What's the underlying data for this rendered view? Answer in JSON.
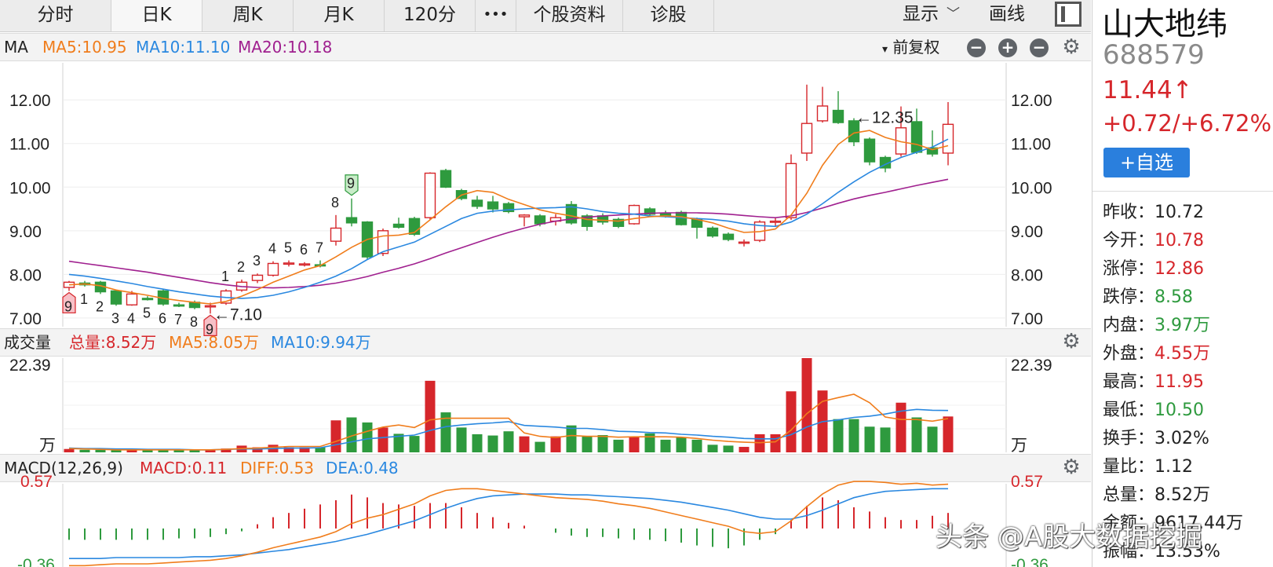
{
  "tabs": [
    {
      "label": "分时",
      "active": false
    },
    {
      "label": "日K",
      "active": true
    },
    {
      "label": "周K",
      "active": false
    },
    {
      "label": "月K",
      "active": false
    },
    {
      "label": "120分",
      "active": false
    },
    {
      "label": "•••",
      "active": false
    },
    {
      "label": "个股资料",
      "active": false
    },
    {
      "label": "诊股",
      "active": false
    }
  ],
  "toolbar": {
    "display_label": "显示",
    "draw_label": "画线"
  },
  "kline_header": {
    "indicator": "MA",
    "ma5": "MA5:10.95",
    "ma10": "MA10:11.10",
    "ma20": "MA20:10.18",
    "adjust_label": "前复权"
  },
  "volume_header": {
    "indicator": "成交量",
    "total": "总量:8.52万",
    "ma5": "MA5:8.05万",
    "ma10": "MA10:9.94万"
  },
  "macd_header": {
    "indicator": "MACD(12,26,9)",
    "macd": "MACD:0.11",
    "diff": "DIFF:0.53",
    "dea": "DEA:0.48"
  },
  "colors": {
    "up": "#d6262b",
    "down": "#2e9a3e",
    "ma5": "#f07d1c",
    "ma10": "#2a88e0",
    "ma20": "#a0208f"
  },
  "chart_data": [
    {
      "type": "candlestick",
      "y_ticks": [
        "12.00",
        "11.00",
        "10.00",
        "9.00",
        "8.00",
        "7.00"
      ],
      "ylim": [
        6.8,
        12.85
      ],
      "annotations": [
        {
          "label": "←12.35",
          "candle_index": 50
        },
        {
          "label": "←7.10",
          "candle_index": 9
        }
      ],
      "td_labels_low": [
        {
          "i": 0,
          "t": "9"
        },
        {
          "i": 1,
          "t": "1"
        },
        {
          "i": 2,
          "t": "2"
        },
        {
          "i": 3,
          "t": "3"
        },
        {
          "i": 4,
          "t": "4"
        },
        {
          "i": 5,
          "t": "5"
        },
        {
          "i": 6,
          "t": "6"
        },
        {
          "i": 7,
          "t": "7"
        },
        {
          "i": 8,
          "t": "8"
        },
        {
          "i": 9,
          "t": "9"
        }
      ],
      "td_labels_high": [
        {
          "i": 10,
          "t": "1"
        },
        {
          "i": 11,
          "t": "2"
        },
        {
          "i": 12,
          "t": "3"
        },
        {
          "i": 13,
          "t": "4"
        },
        {
          "i": 14,
          "t": "5"
        },
        {
          "i": 15,
          "t": "6"
        },
        {
          "i": 16,
          "t": "7"
        },
        {
          "i": 17,
          "t": "8"
        },
        {
          "i": 18,
          "t": "9"
        }
      ],
      "candles": [
        {
          "o": 7.7,
          "h": 7.85,
          "l": 7.62,
          "c": 7.82
        },
        {
          "o": 7.8,
          "h": 7.85,
          "l": 7.72,
          "c": 7.76
        },
        {
          "o": 7.82,
          "h": 7.85,
          "l": 7.55,
          "c": 7.6
        },
        {
          "o": 7.62,
          "h": 7.65,
          "l": 7.28,
          "c": 7.32
        },
        {
          "o": 7.3,
          "h": 7.62,
          "l": 7.28,
          "c": 7.55
        },
        {
          "o": 7.45,
          "h": 7.5,
          "l": 7.4,
          "c": 7.42
        },
        {
          "o": 7.62,
          "h": 7.66,
          "l": 7.28,
          "c": 7.32
        },
        {
          "o": 7.3,
          "h": 7.35,
          "l": 7.25,
          "c": 7.28
        },
        {
          "o": 7.36,
          "h": 7.4,
          "l": 7.2,
          "c": 7.24
        },
        {
          "o": 7.26,
          "h": 7.35,
          "l": 7.1,
          "c": 7.28
        },
        {
          "o": 7.34,
          "h": 7.66,
          "l": 7.3,
          "c": 7.62
        },
        {
          "o": 7.64,
          "h": 7.88,
          "l": 7.6,
          "c": 7.82
        },
        {
          "o": 7.86,
          "h": 8.02,
          "l": 7.8,
          "c": 7.98
        },
        {
          "o": 7.98,
          "h": 8.3,
          "l": 7.95,
          "c": 8.25
        },
        {
          "o": 8.24,
          "h": 8.32,
          "l": 8.18,
          "c": 8.26
        },
        {
          "o": 8.22,
          "h": 8.28,
          "l": 8.18,
          "c": 8.24
        },
        {
          "o": 8.22,
          "h": 8.32,
          "l": 8.16,
          "c": 8.2
        },
        {
          "o": 8.76,
          "h": 9.36,
          "l": 8.66,
          "c": 9.06
        },
        {
          "o": 9.3,
          "h": 9.74,
          "l": 9.1,
          "c": 9.18
        },
        {
          "o": 9.2,
          "h": 9.22,
          "l": 8.35,
          "c": 8.4
        },
        {
          "o": 8.48,
          "h": 9.05,
          "l": 8.42,
          "c": 9.0
        },
        {
          "o": 9.15,
          "h": 9.3,
          "l": 9.05,
          "c": 9.08
        },
        {
          "o": 9.28,
          "h": 9.32,
          "l": 8.88,
          "c": 8.92
        },
        {
          "o": 9.3,
          "h": 10.34,
          "l": 9.25,
          "c": 10.32
        },
        {
          "o": 10.38,
          "h": 10.42,
          "l": 9.98,
          "c": 10.0
        },
        {
          "o": 9.92,
          "h": 9.96,
          "l": 9.7,
          "c": 9.74
        },
        {
          "o": 9.7,
          "h": 9.8,
          "l": 9.5,
          "c": 9.56
        },
        {
          "o": 9.66,
          "h": 9.8,
          "l": 9.42,
          "c": 9.5
        },
        {
          "o": 9.62,
          "h": 9.66,
          "l": 9.4,
          "c": 9.44
        },
        {
          "o": 9.32,
          "h": 9.38,
          "l": 9.1,
          "c": 9.36
        },
        {
          "o": 9.34,
          "h": 9.38,
          "l": 9.1,
          "c": 9.16
        },
        {
          "o": 9.22,
          "h": 9.38,
          "l": 9.12,
          "c": 9.3
        },
        {
          "o": 9.6,
          "h": 9.68,
          "l": 9.14,
          "c": 9.18
        },
        {
          "o": 9.34,
          "h": 9.38,
          "l": 9.0,
          "c": 9.1
        },
        {
          "o": 9.34,
          "h": 9.4,
          "l": 9.14,
          "c": 9.2
        },
        {
          "o": 9.26,
          "h": 9.3,
          "l": 9.06,
          "c": 9.1
        },
        {
          "o": 9.16,
          "h": 9.6,
          "l": 9.14,
          "c": 9.58
        },
        {
          "o": 9.5,
          "h": 9.54,
          "l": 9.34,
          "c": 9.38
        },
        {
          "o": 9.4,
          "h": 9.46,
          "l": 9.3,
          "c": 9.34
        },
        {
          "o": 9.42,
          "h": 9.46,
          "l": 9.12,
          "c": 9.14
        },
        {
          "o": 9.26,
          "h": 9.3,
          "l": 8.82,
          "c": 9.08
        },
        {
          "o": 9.06,
          "h": 9.1,
          "l": 8.84,
          "c": 8.88
        },
        {
          "o": 8.92,
          "h": 8.96,
          "l": 8.76,
          "c": 8.8
        },
        {
          "o": 8.72,
          "h": 8.8,
          "l": 8.64,
          "c": 8.74
        },
        {
          "o": 8.78,
          "h": 9.24,
          "l": 8.74,
          "c": 9.2
        },
        {
          "o": 9.2,
          "h": 9.3,
          "l": 9.1,
          "c": 9.22
        },
        {
          "o": 9.3,
          "h": 10.75,
          "l": 9.25,
          "c": 10.54
        },
        {
          "o": 10.78,
          "h": 12.35,
          "l": 10.6,
          "c": 11.46
        },
        {
          "o": 11.52,
          "h": 12.3,
          "l": 11.48,
          "c": 11.86
        },
        {
          "o": 11.76,
          "h": 12.2,
          "l": 11.45,
          "c": 11.48
        },
        {
          "o": 11.52,
          "h": 11.58,
          "l": 10.94,
          "c": 11.04
        },
        {
          "o": 11.1,
          "h": 11.14,
          "l": 10.5,
          "c": 10.58
        },
        {
          "o": 10.68,
          "h": 10.72,
          "l": 10.34,
          "c": 10.44
        },
        {
          "o": 10.76,
          "h": 11.85,
          "l": 10.7,
          "c": 11.36
        },
        {
          "o": 11.5,
          "h": 11.8,
          "l": 10.76,
          "c": 10.8
        },
        {
          "o": 10.9,
          "h": 11.3,
          "l": 10.7,
          "c": 10.76
        },
        {
          "o": 10.78,
          "h": 11.95,
          "l": 10.5,
          "c": 11.44
        }
      ],
      "ma5": [
        7.76,
        7.78,
        7.74,
        7.64,
        7.58,
        7.52,
        7.45,
        7.4,
        7.36,
        7.32,
        7.38,
        7.5,
        7.65,
        7.82,
        7.96,
        8.1,
        8.2,
        8.4,
        8.62,
        8.8,
        8.88,
        8.9,
        8.96,
        9.25,
        9.55,
        9.82,
        9.92,
        9.88,
        9.72,
        9.6,
        9.48,
        9.4,
        9.34,
        9.26,
        9.24,
        9.22,
        9.28,
        9.32,
        9.34,
        9.32,
        9.26,
        9.18,
        9.06,
        8.96,
        8.98,
        9.04,
        9.36,
        9.86,
        10.5,
        10.98,
        11.24,
        11.3,
        11.14,
        11.04,
        10.98,
        10.86,
        10.95
      ],
      "ma10": [
        8.0,
        7.96,
        7.91,
        7.85,
        7.79,
        7.72,
        7.66,
        7.6,
        7.55,
        7.5,
        7.47,
        7.45,
        7.47,
        7.52,
        7.6,
        7.7,
        7.82,
        7.96,
        8.13,
        8.34,
        8.52,
        8.63,
        8.74,
        8.92,
        9.1,
        9.28,
        9.4,
        9.45,
        9.48,
        9.5,
        9.52,
        9.53,
        9.55,
        9.5,
        9.44,
        9.4,
        9.38,
        9.34,
        9.32,
        9.3,
        9.28,
        9.26,
        9.22,
        9.16,
        9.12,
        9.1,
        9.2,
        9.38,
        9.62,
        9.88,
        10.12,
        10.34,
        10.52,
        10.68,
        10.8,
        10.92,
        11.1
      ],
      "ma20": [
        8.3,
        8.25,
        8.2,
        8.15,
        8.1,
        8.05,
        7.99,
        7.93,
        7.87,
        7.81,
        7.76,
        7.72,
        7.7,
        7.69,
        7.7,
        7.72,
        7.75,
        7.8,
        7.87,
        7.95,
        8.05,
        8.14,
        8.24,
        8.36,
        8.49,
        8.61,
        8.73,
        8.85,
        8.96,
        9.06,
        9.15,
        9.22,
        9.27,
        9.31,
        9.34,
        9.36,
        9.38,
        9.4,
        9.41,
        9.41,
        9.41,
        9.4,
        9.38,
        9.35,
        9.32,
        9.3,
        9.34,
        9.42,
        9.52,
        9.63,
        9.73,
        9.81,
        9.88,
        9.96,
        10.04,
        10.11,
        10.18
      ]
    },
    {
      "type": "bar",
      "y_tick_top": "22.39",
      "y_unit": "万",
      "ylim": [
        0,
        22.39
      ],
      "values": [
        0.8,
        0.6,
        0.6,
        0.6,
        0.6,
        0.6,
        0.6,
        0.6,
        0.6,
        0.6,
        0.9,
        1.6,
        1.2,
        1.8,
        1.2,
        1.2,
        1.2,
        7.6,
        8.3,
        7.1,
        5.9,
        4.4,
        3.9,
        17.0,
        9.5,
        5.9,
        4.3,
        4.0,
        5.0,
        3.8,
        2.5,
        3.8,
        6.4,
        3.8,
        4.1,
        3.0,
        3.6,
        4.5,
        3.0,
        3.6,
        3.0,
        1.8,
        1.6,
        1.3,
        4.3,
        4.3,
        14.5,
        22.39,
        14.7,
        7.9,
        7.9,
        6.1,
        5.9,
        11.8,
        8.3,
        6.1,
        8.52
      ],
      "ma5": [
        0.9,
        0.8,
        0.7,
        0.6,
        0.6,
        0.6,
        0.6,
        0.6,
        0.6,
        0.6,
        0.7,
        0.9,
        1.0,
        1.2,
        1.4,
        1.4,
        1.4,
        2.6,
        3.9,
        5.0,
        6.0,
        6.5,
        5.9,
        7.7,
        8.1,
        8.1,
        8.1,
        8.1,
        8.1,
        4.6,
        3.8,
        3.5,
        4.0,
        3.8,
        3.8,
        3.6,
        3.7,
        3.7,
        3.7,
        3.6,
        3.3,
        2.9,
        2.6,
        2.4,
        2.3,
        2.5,
        5.3,
        9.2,
        12.1,
        13.0,
        13.8,
        11.8,
        8.4,
        7.8,
        7.8,
        7.4,
        8.05
      ],
      "ma10": [
        1.0,
        0.9,
        0.9,
        0.8,
        0.8,
        0.7,
        0.7,
        0.7,
        0.6,
        0.6,
        0.7,
        0.8,
        0.8,
        0.9,
        1.0,
        1.0,
        1.1,
        1.8,
        2.5,
        3.2,
        3.5,
        3.8,
        4.1,
        5.2,
        6.1,
        6.5,
        6.8,
        7.0,
        7.3,
        6.4,
        6.2,
        6.0,
        5.7,
        5.7,
        5.4,
        5.0,
        4.9,
        4.7,
        4.6,
        4.3,
        4.1,
        3.8,
        3.6,
        3.3,
        3.2,
        3.2,
        4.2,
        6.0,
        7.3,
        7.7,
        8.3,
        8.6,
        9.1,
        9.8,
        10.2,
        10.0,
        9.94
      ]
    },
    {
      "type": "line",
      "y_tick_top": "0.57",
      "y_tick_bottom": "-0.36",
      "ylim": [
        -0.36,
        0.57
      ],
      "macd": [
        -0.08,
        -0.08,
        -0.08,
        -0.08,
        -0.08,
        -0.08,
        -0.08,
        -0.07,
        -0.07,
        -0.06,
        -0.04,
        -0.02,
        0.03,
        0.08,
        0.11,
        0.14,
        0.17,
        0.2,
        0.24,
        0.22,
        0.18,
        0.17,
        0.16,
        0.18,
        0.18,
        0.15,
        0.11,
        0.08,
        0.04,
        0.02,
        0.0,
        -0.03,
        -0.05,
        -0.06,
        -0.06,
        -0.07,
        -0.08,
        -0.08,
        -0.09,
        -0.1,
        -0.12,
        -0.13,
        -0.14,
        -0.12,
        -0.08,
        -0.04,
        0.06,
        0.16,
        0.22,
        0.2,
        0.15,
        0.12,
        0.08,
        0.06,
        0.06,
        0.09,
        0.11
      ],
      "diff": [
        -0.38,
        -0.38,
        -0.37,
        -0.36,
        -0.36,
        -0.36,
        -0.35,
        -0.34,
        -0.33,
        -0.32,
        -0.3,
        -0.27,
        -0.23,
        -0.18,
        -0.14,
        -0.1,
        -0.06,
        0.0,
        0.09,
        0.15,
        0.19,
        0.25,
        0.31,
        0.4,
        0.46,
        0.48,
        0.48,
        0.46,
        0.44,
        0.42,
        0.4,
        0.38,
        0.37,
        0.36,
        0.34,
        0.31,
        0.29,
        0.26,
        0.22,
        0.18,
        0.14,
        0.1,
        0.06,
        0.0,
        -0.02,
        0.0,
        0.12,
        0.28,
        0.42,
        0.52,
        0.56,
        0.56,
        0.55,
        0.53,
        0.54,
        0.52,
        0.53
      ],
      "dea": [
        -0.3,
        -0.3,
        -0.3,
        -0.29,
        -0.29,
        -0.29,
        -0.29,
        -0.29,
        -0.28,
        -0.28,
        -0.27,
        -0.26,
        -0.24,
        -0.22,
        -0.2,
        -0.17,
        -0.14,
        -0.11,
        -0.07,
        -0.03,
        0.02,
        0.07,
        0.12,
        0.19,
        0.26,
        0.32,
        0.37,
        0.4,
        0.41,
        0.42,
        0.42,
        0.42,
        0.41,
        0.41,
        0.4,
        0.39,
        0.38,
        0.37,
        0.35,
        0.33,
        0.3,
        0.27,
        0.24,
        0.2,
        0.16,
        0.14,
        0.14,
        0.18,
        0.24,
        0.31,
        0.38,
        0.42,
        0.45,
        0.46,
        0.47,
        0.48,
        0.48
      ]
    }
  ],
  "stock": {
    "name": "山大地纬",
    "code": "688579",
    "price": "11.44↑",
    "change": "+0.72/+6.72%",
    "fav_label": "+自选"
  },
  "stats": [
    {
      "key": "昨收：",
      "value": "10.72",
      "tone": "black"
    },
    {
      "key": "今开：",
      "value": "10.78",
      "tone": "red"
    },
    {
      "key": "涨停：",
      "value": "12.86",
      "tone": "red"
    },
    {
      "key": "跌停：",
      "value": "8.58",
      "tone": "green"
    },
    {
      "key": "内盘：",
      "value": "3.97万",
      "tone": "green"
    },
    {
      "key": "外盘：",
      "value": "4.55万",
      "tone": "red"
    },
    {
      "key": "最高：",
      "value": "11.95",
      "tone": "red"
    },
    {
      "key": "最低：",
      "value": "10.50",
      "tone": "green"
    },
    {
      "key": "换手：",
      "value": "3.02%",
      "tone": "black"
    },
    {
      "key": "量比：",
      "value": "1.12",
      "tone": "black"
    },
    {
      "key": "总量：",
      "value": "8.52万",
      "tone": "black"
    },
    {
      "key": "金额：",
      "value": "9617.44万",
      "tone": "black"
    },
    {
      "key": "振幅：",
      "value": "13.53%",
      "tone": "black"
    }
  ],
  "watermark": "头条 @A股大数据挖掘"
}
